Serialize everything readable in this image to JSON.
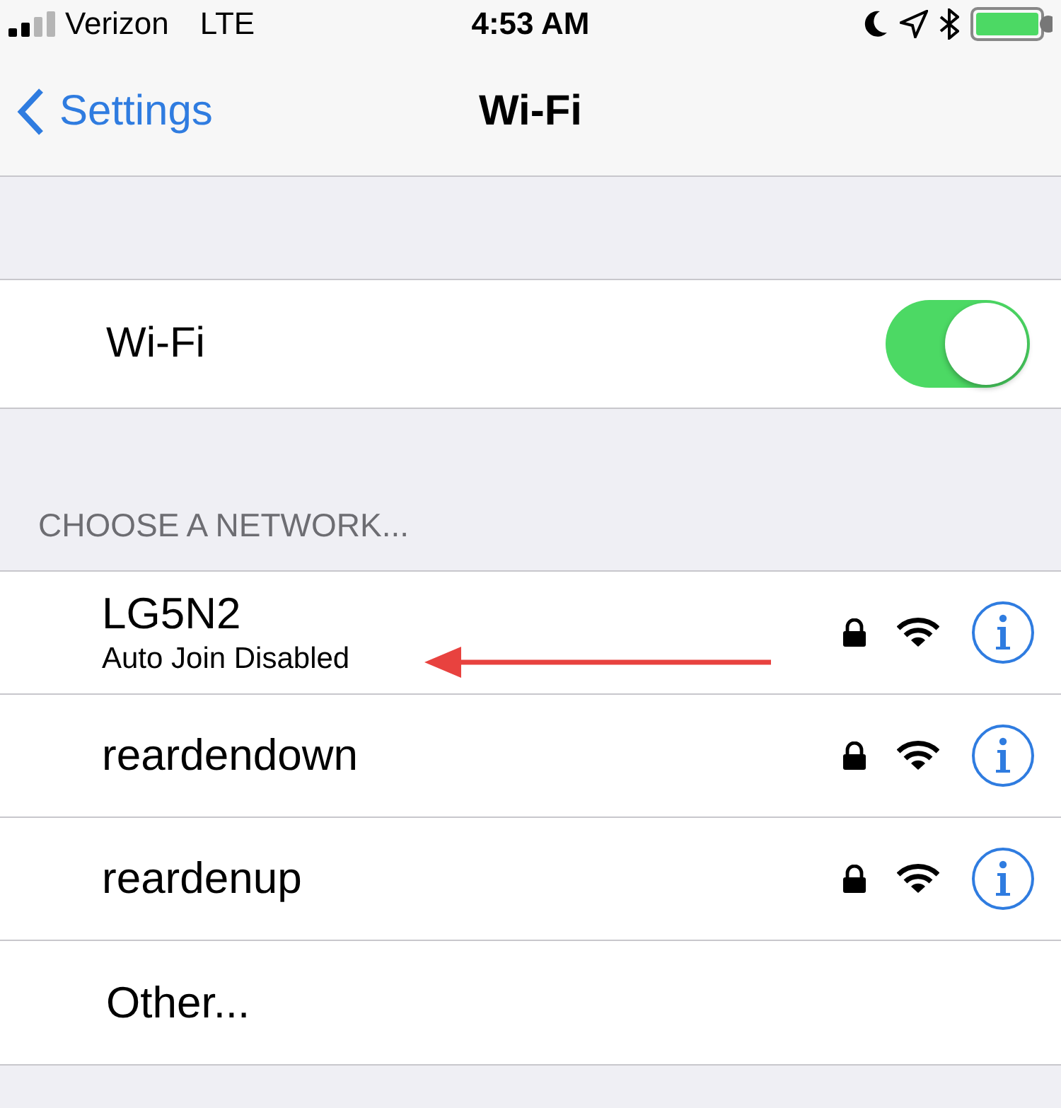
{
  "status_bar": {
    "carrier": "Verizon",
    "network": "LTE",
    "time": "4:53 AM"
  },
  "nav": {
    "back": "Settings",
    "title": "Wi-Fi"
  },
  "wifi": {
    "label": "Wi-Fi",
    "on": true
  },
  "section_header": "CHOOSE A NETWORK...",
  "networks": [
    {
      "name": "LG5N2",
      "subtitle": "Auto Join Disabled",
      "locked": true
    },
    {
      "name": "reardendown",
      "locked": true
    },
    {
      "name": "reardenup",
      "locked": true
    }
  ],
  "other": "Other..."
}
